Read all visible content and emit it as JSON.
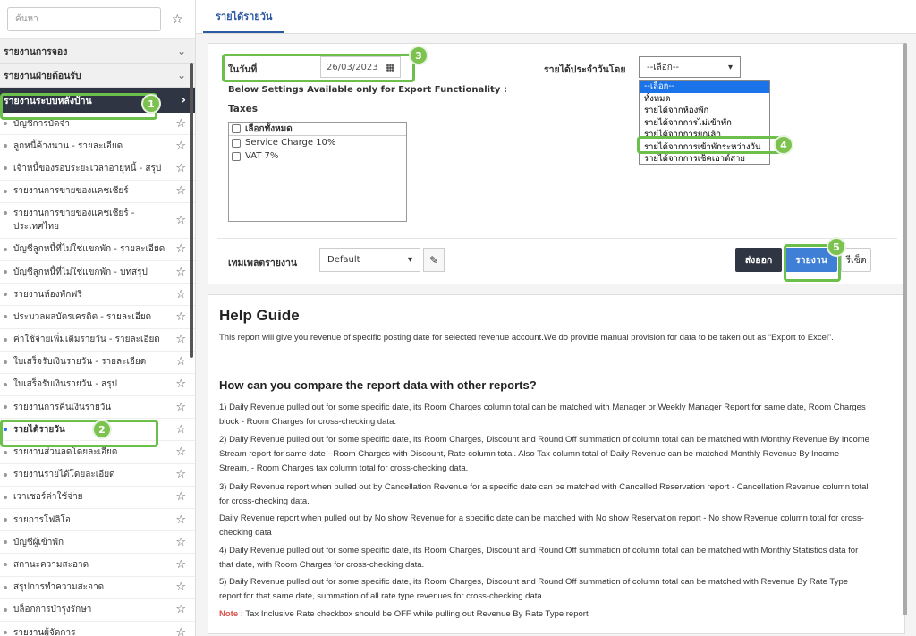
{
  "sidebar": {
    "search_placeholder": "ค้นหา",
    "sections": [
      {
        "label": "รายงานการจอง"
      },
      {
        "label": "รายงานฝ่ายต้อนรับ"
      }
    ],
    "active_section": {
      "label": "รายงานระบบหลังบ้าน"
    },
    "items": [
      {
        "label": "บัญชีการบัดจำ"
      },
      {
        "label": "ลูกหนี้ค้างนาน - รายละเอียด"
      },
      {
        "label": "เจ้าหนี้ของรอบระยะเวลาอายุหนี้ - สรุป"
      },
      {
        "label": "รายงานการขายของแคชเชียร์"
      },
      {
        "label": "รายงานการขายของแคชเชียร์ - ประเทศไทย"
      },
      {
        "label": "บัญชีลูกหนี้ที่ไม่ใช่แขกพัก - รายละเอียด"
      },
      {
        "label": "บัญชีลูกหนี้ที่ไม่ใช่แขกพัก - บทสรุป"
      },
      {
        "label": "รายงานห้องพักฟรี"
      },
      {
        "label": "ประมวลผลบัตรเครดิต - รายละเอียด"
      },
      {
        "label": "ค่าใช้จ่ายเพิ่มเติมรายวัน - รายละเอียด"
      },
      {
        "label": "ใบเสร็จรับเงินรายวัน - รายละเอียด"
      },
      {
        "label": "ใบเสร็จรับเงินรายวัน - สรุป"
      },
      {
        "label": "รายงานการคืนเงินรายวัน"
      },
      {
        "label": "รายได้รายวัน"
      },
      {
        "label": "รายงานส่วนลดโดยละเอียด"
      },
      {
        "label": "รายงานรายได้โดยละเอียด"
      },
      {
        "label": "เวาเชอร์ค่าใช้จ่าย"
      },
      {
        "label": "รายการโฟลิโอ"
      },
      {
        "label": "บัญชีผู้เข้าพัก"
      },
      {
        "label": "สถานะความสะอาด"
      },
      {
        "label": "สรุปการทำความสะอาด"
      },
      {
        "label": "บล็อกการบำรุงรักษา"
      },
      {
        "label": "รายงานผู้จัดการ"
      }
    ]
  },
  "main": {
    "tab": "รายได้รายวัน",
    "date_label": "ในวันที่",
    "date_value": "26/03/2023",
    "settings_note": "Below Settings Available only for Export Functionality :",
    "taxes_label": "Taxes",
    "taxes": {
      "select_all": "เลือกทั้งหมด",
      "items": [
        "Service Charge 10%",
        "VAT 7%"
      ]
    },
    "revenue_by_label": "รายได้ประจำวันโดย",
    "revenue_by_value": "--เลือก--",
    "revenue_options": [
      "--เลือก--",
      "ทั้งหมด",
      "รายได้จากห้องพัก",
      "รายได้จากการไม่เข้าพัก",
      "รายได้จากการยกเลิก",
      "รายได้จากการเข้าพักระหว่างวัน",
      "รายได้จากการเช็คเอาต์สาย"
    ],
    "template_label": "เทมเพลตรายงาน",
    "template_value": "Default",
    "export_label": "ส่งออก",
    "report_label": "รายงาน",
    "reset_label": "รีเซ็ต"
  },
  "callouts": [
    "1",
    "2",
    "3",
    "4",
    "5"
  ],
  "help": {
    "title": "Help Guide",
    "intro": "This report will give you revenue of specific posting date for selected revenue account.We do provide manual provision for data to be taken out as “Export to Excel”.",
    "subtitle": "How can you compare the report data with other reports?",
    "p1": "1) Daily Revenue pulled out for some specific date, its Room Charges column total can be matched with Manager or Weekly Manager Report for same date, Room Charges block - Room Charges for cross-checking data.",
    "p2": "2) Daily Revenue pulled out for some specific date, its Room Charges, Discount and Round Off summation of column total can be matched with Monthly Revenue By Income Stream report for same date - Room Charges with Discount, Rate column total. Also Tax column total of Daily Revenue can be matched Monthly Revenue By Income Stream, - Room Charges tax column total for cross-checking data.",
    "p3": "3) Daily Revenue report when pulled out by Cancellation Revenue for a specific date can be matched with Cancelled Reservation report - Cancellation Revenue column total for cross-checking data.",
    "p3b": "Daily Revenue report when pulled out by No show Revenue for a specific date can be matched with No show Reservation report - No show Revenue column total for cross-checking data",
    "p4": "4) Daily Revenue pulled out for some specific date, its Room Charges, Discount and Round Off summation of column total can be matched with Monthly Statistics data for that date, with Room Charges for cross-checking data.",
    "p5": "5) Daily Revenue pulled out for some specific date, its Room Charges, Discount and Round Off summation of column total can be matched with Revenue By Rate Type report for that same date, summation of all rate type revenues for cross-checking data.",
    "note_label": "Note :",
    "note_text": " Tax Inclusive Rate checkbox should be OFF while pulling out Revenue By Rate Type report"
  }
}
